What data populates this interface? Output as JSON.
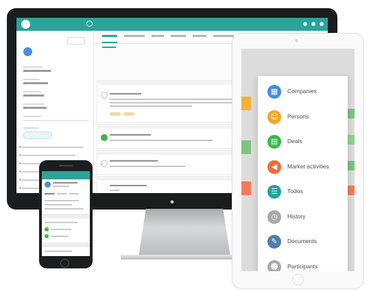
{
  "mobile_menu": {
    "items": [
      {
        "label": "Companies",
        "icon": "companies-icon",
        "color": "#3d8fe0",
        "glyph": "▦"
      },
      {
        "label": "Persons",
        "icon": "persons-icon",
        "color": "#f5a623",
        "glyph": "☺"
      },
      {
        "label": "Deals",
        "icon": "deals-icon",
        "color": "#3bb54a",
        "glyph": "▤"
      },
      {
        "label": "Market activities",
        "icon": "market-activities-icon",
        "color": "#f26b3a",
        "glyph": "◀"
      },
      {
        "label": "Todos",
        "icon": "todos-icon",
        "color": "#1ea599",
        "glyph": "☰"
      },
      {
        "label": "History",
        "icon": "history-icon",
        "color": "#a7a9ac",
        "glyph": "◷"
      },
      {
        "label": "Documents",
        "icon": "documents-icon",
        "color": "#4f7fa8",
        "glyph": "✎"
      },
      {
        "label": "Participants",
        "icon": "participants-icon",
        "color": "#a7a9ac",
        "glyph": "☻"
      }
    ]
  },
  "colors": {
    "brand_teal": "#2ea39a",
    "imac_bezel": "#1b1c1e"
  }
}
